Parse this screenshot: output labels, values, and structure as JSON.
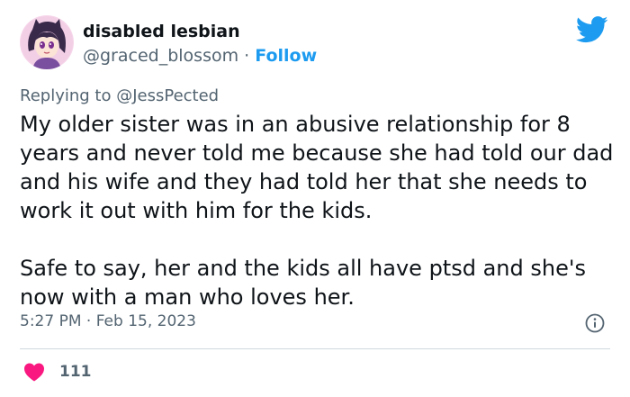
{
  "author": {
    "display_name": "disabled lesbian",
    "handle": "@graced_blossom",
    "separator": "·",
    "follow_label": "Follow",
    "avatar_icon": "anime-avatar"
  },
  "reply": {
    "prefix": "Replying to",
    "mention": "@JessPected"
  },
  "tweet": {
    "paragraphs": [
      "My older sister was in an abusive relationship for 8 years and never told me because she had told our dad and his wife and they had told her that she needs to work it out with him for the kids.",
      "Safe to say, her and the kids all have ptsd and she's now with a man who loves her."
    ],
    "timestamp": "5:27 PM · Feb 15, 2023"
  },
  "engagement": {
    "likes_count": "111",
    "like_icon": "heart-icon",
    "info_icon": "info-icon"
  },
  "colors": {
    "brand_blue": "#1d9bf0",
    "heart_red": "#f91880",
    "secondary_text": "#536471",
    "divider": "#cfd9de"
  }
}
